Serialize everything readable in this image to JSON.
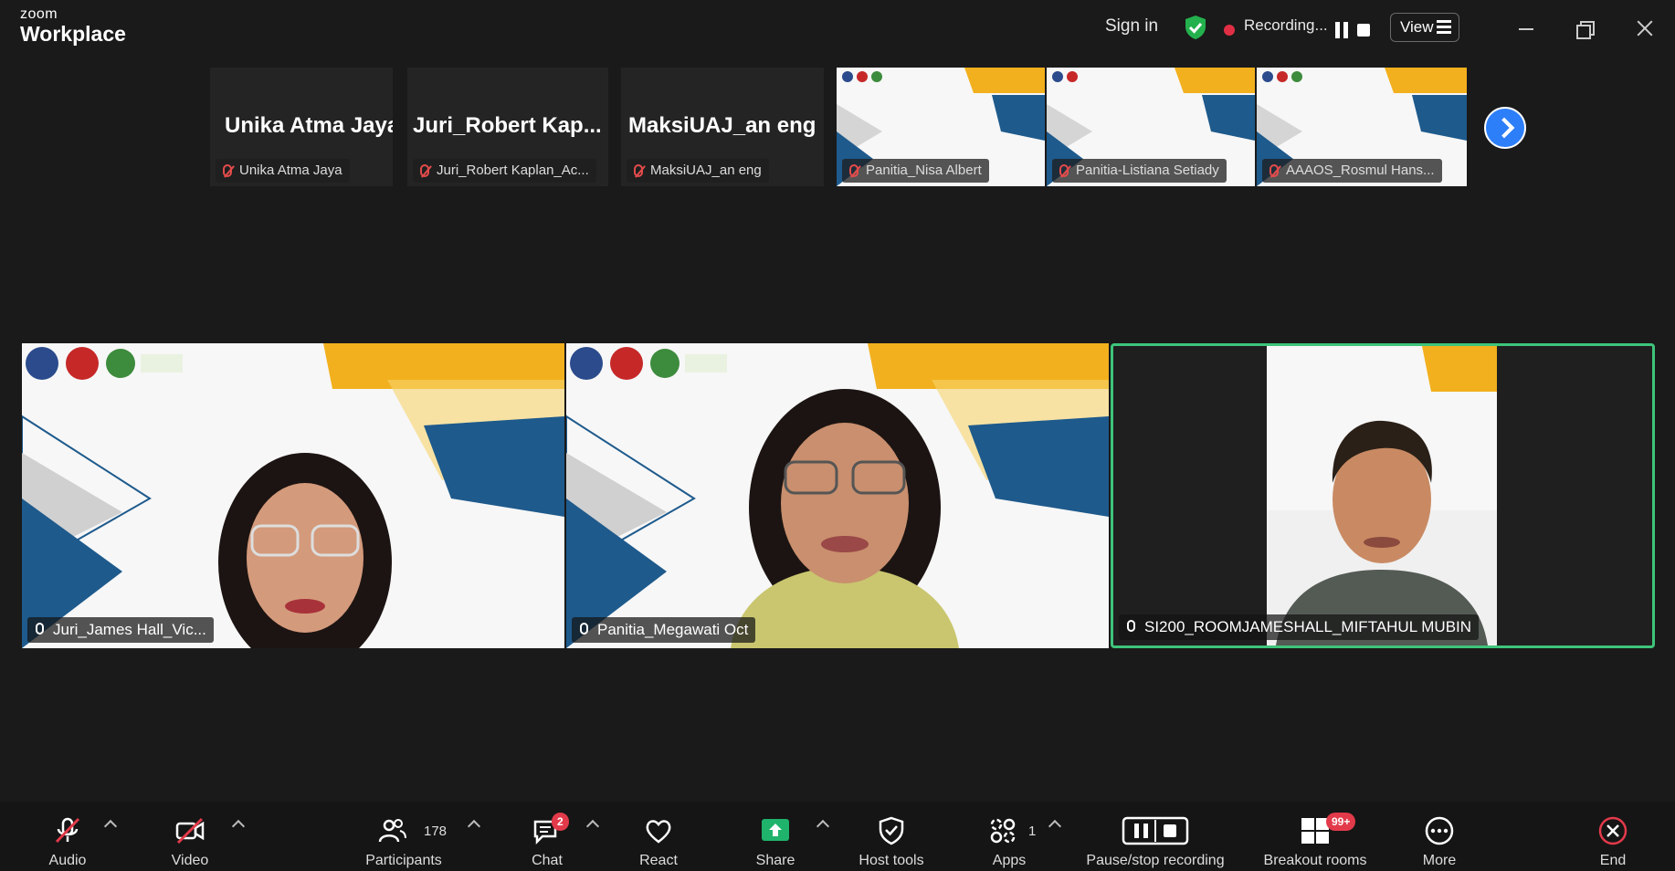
{
  "app": {
    "brand_line1": "zoom",
    "brand_line2": "Workplace"
  },
  "titlebar": {
    "sign_in": "Sign in",
    "recording_text": "Recording...",
    "view_label": "View"
  },
  "filmstrip": {
    "tiles": [
      {
        "display": "Unika Atma Jaya",
        "label": "Unika Atma Jaya"
      },
      {
        "display": "Juri_Robert  Kap...",
        "label": "Juri_Robert Kaplan_Ac..."
      },
      {
        "display": "MaksiUAJ_an eng",
        "label": "MaksiUAJ_an eng"
      },
      {
        "label": "Panitia_Nisa Albert"
      },
      {
        "label": "Panitia-Listiana Setiady"
      },
      {
        "label": "AAAOS_Rosmul Hans..."
      }
    ]
  },
  "main_tiles": [
    {
      "label": "Juri_James Hall_Vic..."
    },
    {
      "label": "Panitia_Megawati Oct"
    },
    {
      "label": "SI200_ROOMJAMESHALL_MIFTAHUL MUBIN"
    }
  ],
  "toolbar": {
    "audio": "Audio",
    "video": "Video",
    "participants": "Participants",
    "participants_count": "178",
    "chat": "Chat",
    "chat_badge": "2",
    "react": "React",
    "share": "Share",
    "host_tools": "Host tools",
    "apps": "Apps",
    "apps_count": "1",
    "pause_stop": "Pause/stop recording",
    "breakout": "Breakout rooms",
    "breakout_badge": "99+",
    "more": "More",
    "end": "End"
  },
  "colors": {
    "background": "#1a1a1a",
    "active_speaker": "#3ec47a",
    "share_green": "#1fb36b",
    "alert_red": "#e23a4a",
    "accent_blue": "#2d7ff9",
    "slide_blue": "#1e5a8c",
    "slide_yellow": "#f2b01e"
  }
}
